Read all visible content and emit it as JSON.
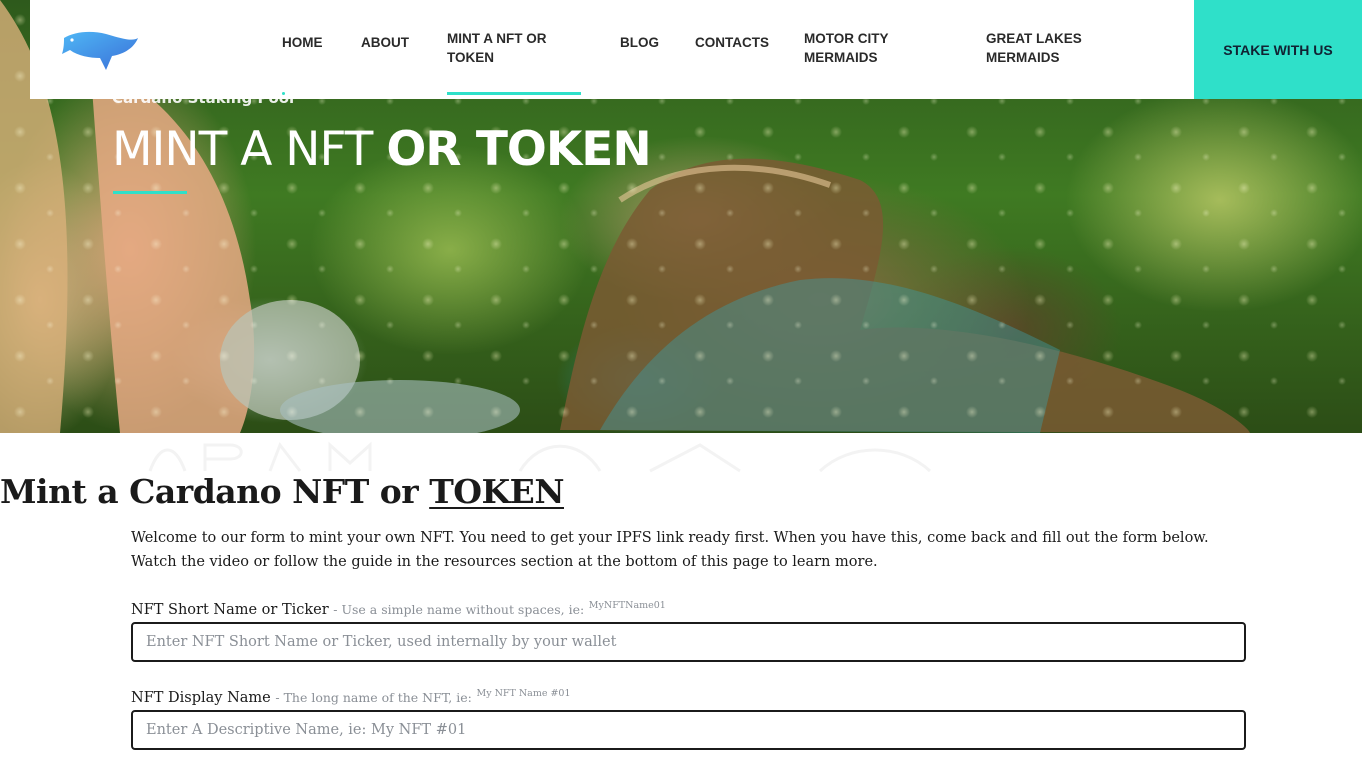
{
  "header": {
    "nav": [
      {
        "line1": "HOME",
        "line2": ""
      },
      {
        "line1": "ABOUT",
        "line2": ""
      },
      {
        "line1": "MINT A NFT OR",
        "line2": "TOKEN"
      },
      {
        "line1": "BLOG",
        "line2": ""
      },
      {
        "line1": "CONTACTS",
        "line2": ""
      },
      {
        "line1": "MOTOR CITY",
        "line2": "MERMAIDS"
      },
      {
        "line1": "GREAT LAKES",
        "line2": "MERMAIDS"
      }
    ],
    "cta_label": "STAKE WITH US",
    "logo_icon": "turtle-logo-icon"
  },
  "hero": {
    "subtitle": "Cardano Staking Pool",
    "title_light": "MINT A NFT",
    "title_bold": "OR TOKEN"
  },
  "main": {
    "heading_prefix": "Mint a Cardano NFT or",
    "heading_link": "TOKEN",
    "intro": "Welcome to our form to mint your own NFT. You need to get your IPFS link ready first. When you have this, come back and fill out the form below. Watch the video or follow the guide in the resources section at the bottom of this page to learn more.",
    "fields": [
      {
        "label": "NFT Short Name or Ticker",
        "hint": "Use a simple name without spaces, ie:",
        "example": "MyNFTName01",
        "value": "",
        "placeholder": "Enter NFT Short Name or Ticker, used internally by your wallet"
      },
      {
        "label": "NFT Display Name",
        "hint": "The long name of the NFT, ie:",
        "example": "My NFT Name #01",
        "value": "",
        "placeholder": "Enter A Descriptive Name, ie: My NFT #01"
      }
    ]
  },
  "colors": {
    "accent": "#2fe0c9",
    "text": "#1a1a1a",
    "hint": "#8a8f96"
  }
}
